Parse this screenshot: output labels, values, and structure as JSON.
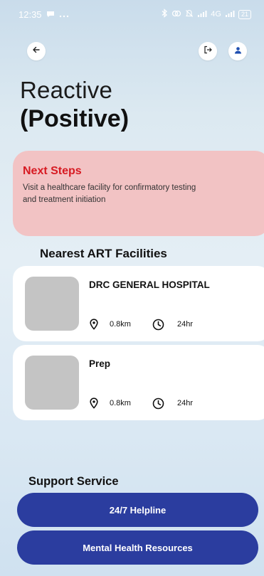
{
  "status_bar": {
    "time": "12:35",
    "network": "4G",
    "battery": "21"
  },
  "header": {
    "back_icon": "arrow-left-icon",
    "logout_icon": "logout-icon",
    "profile_icon": "person-icon"
  },
  "result": {
    "title": "Reactive",
    "subtitle": "(Positive)"
  },
  "next_steps": {
    "title": "Next Steps",
    "body": "Visit a healthcare facility for confirmatory testing and treatment initiation",
    "background": "#f2c3c4",
    "title_color": "#d71a22"
  },
  "facilities": {
    "title": "Nearest ART Facilities",
    "items": [
      {
        "name": "DRC GENERAL HOSPITAL",
        "distance": "0.8km",
        "hours": "24hr"
      },
      {
        "name": "Prep",
        "distance": "0.8km",
        "hours": "24hr"
      }
    ]
  },
  "support": {
    "title": "Support Service",
    "helpline_label": "24/7 Helpline",
    "mental_health_label": "Mental Health Resources",
    "button_color": "#2b3d9f"
  }
}
